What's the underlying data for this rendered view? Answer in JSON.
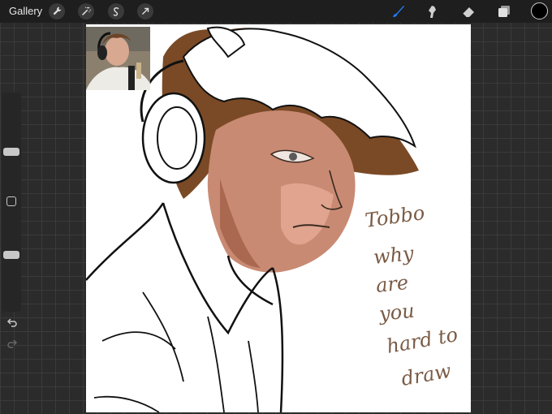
{
  "toolbar": {
    "gallery_label": "Gallery",
    "left_tools": [
      "wrench-icon",
      "magic-wand-icon",
      "selection-icon",
      "transform-arrow-icon"
    ],
    "right_tools": [
      "brush-icon",
      "smudge-icon",
      "eraser-icon",
      "layers-icon"
    ],
    "active_tool": "brush",
    "active_tool_color": "#1e7cf2",
    "current_color": "#000000"
  },
  "sidebar": {
    "brush_size_level": 0.35,
    "opacity_level": 0.6
  },
  "canvas": {
    "handwritten_note": [
      "Tobbo",
      "why",
      "are",
      "you",
      "hard to",
      "draw"
    ],
    "note_color": "#7a5a44",
    "skin_color": "#c98a73",
    "hair_color": "#7a4a26"
  }
}
